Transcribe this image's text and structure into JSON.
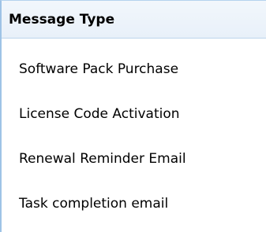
{
  "header": {
    "label": "Message Type"
  },
  "items": [
    {
      "label": "Software Pack Purchase"
    },
    {
      "label": "License Code Activation"
    },
    {
      "label": "Renewal Reminder Email"
    },
    {
      "label": "Task completion email"
    }
  ],
  "colors": {
    "border": "#9ec3e6",
    "header_bg": "#eaf2fa"
  }
}
